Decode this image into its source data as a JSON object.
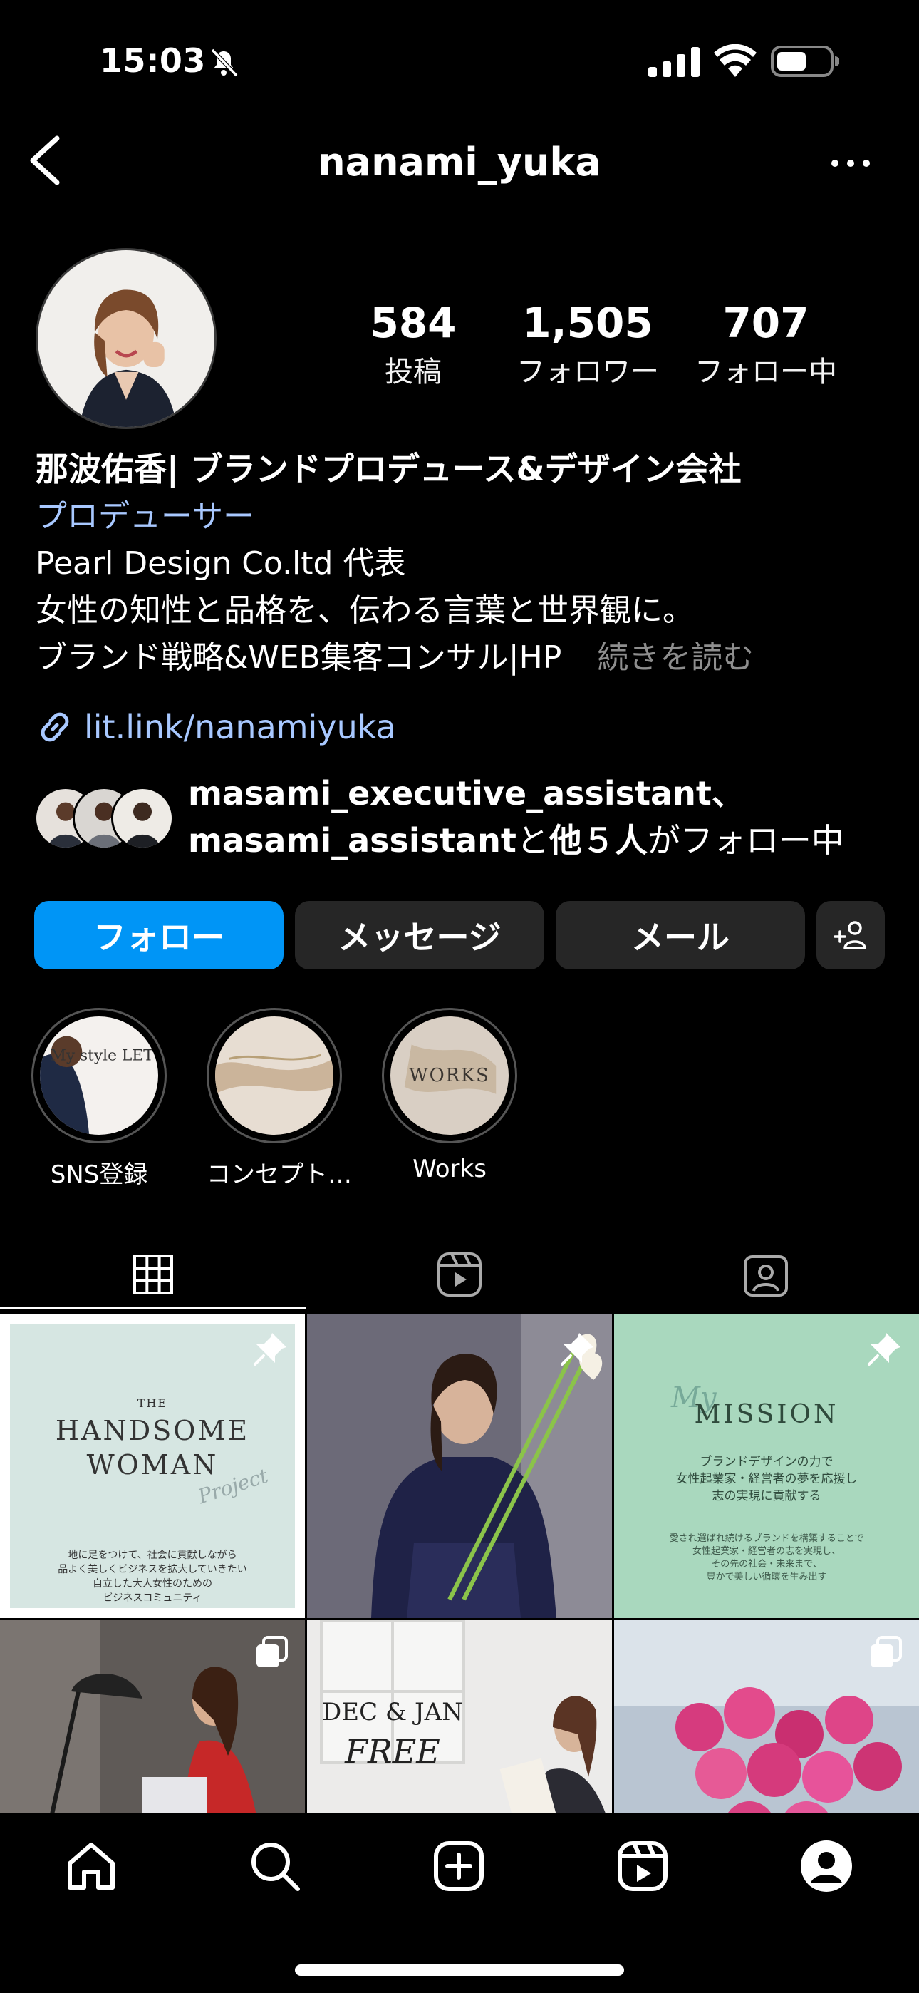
{
  "status_bar": {
    "time": "15:03"
  },
  "header": {
    "username": "nanami_yuka"
  },
  "stats": {
    "posts": {
      "value": "584",
      "label": "投稿"
    },
    "followers": {
      "value": "1,505",
      "label": "フォロワー"
    },
    "following": {
      "value": "707",
      "label": "フォロー中"
    }
  },
  "bio": {
    "name": "那波佑香| ブランドプロデュース&デザイン会社",
    "category": "プロデューサー",
    "lines": [
      "Pearl Design Co.ltd 代表",
      "女性の知性と品格を、伝わる言葉と世界観に。",
      "ブランド戦略&WEB集客コンサル|HP"
    ],
    "more": "続きを読む",
    "link": "lit.link/nanamiyuka"
  },
  "followed_by": {
    "line1": "masami_executive_assistant、",
    "user2": "masami_assistant",
    "conj": "と",
    "others": "他５人",
    "suffix": "がフォロー中"
  },
  "buttons": {
    "follow": "フォロー",
    "message": "メッセージ",
    "email": "メール"
  },
  "highlights": [
    {
      "label": "SNS登録",
      "cover_text": "My style LETTER"
    },
    {
      "label": "コンセプト…"
    },
    {
      "label": "Works",
      "cover_text": "WORKS"
    }
  ],
  "posts": [
    {
      "pinned": true,
      "title_small": "THE",
      "title1": "HANDSOME",
      "title2": "WOMAN",
      "script": "Project",
      "caption1": "地に足をつけて、社会に貢献しながら",
      "caption2": "品よく美しくビジネスを拡大していきたい",
      "caption3": "自立した大人女性のための",
      "caption4": "ビジネスコミュニティ"
    },
    {
      "pinned": true
    },
    {
      "pinned": true,
      "script": "My",
      "title": "MISSION",
      "line1": "ブランドデザインの力で",
      "line2": "女性起業家・経営者の夢を応援し",
      "line3": "志の実現に貢献する",
      "sub1": "愛され選ばれ続けるブランドを構築することで",
      "sub2": "女性起業家・経営者の志を実現し、",
      "sub3": "その先の社会・未来まで、",
      "sub4": "豊かで美しい循環を生み出す"
    },
    {
      "multi": true
    },
    {
      "title1": "DEC & JAN",
      "title2": "FREE"
    },
    {
      "multi": true
    }
  ],
  "colors": {
    "accent": "#0095f6",
    "link": "#a8c8ff",
    "button_bg": "#262626",
    "muted": "#8e8e8e"
  }
}
